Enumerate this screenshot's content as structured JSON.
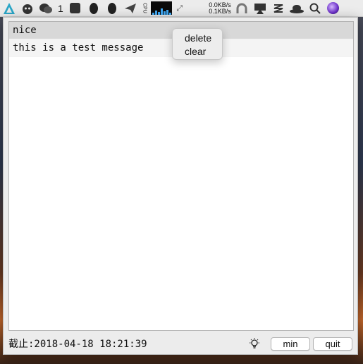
{
  "menubar": {
    "icons": [
      "app-a-icon",
      "cat-icon",
      "wechat-icon",
      "note-icon",
      "qq-icon",
      "qq-icon",
      "paper-plane-icon",
      "cpu-icon",
      "activity-graph-icon",
      "expand-icon",
      "network-speed-icon",
      "headphones-icon",
      "airplay-icon",
      "zip-icon",
      "hat-icon",
      "search-icon",
      "siri-icon"
    ],
    "wechat_count": "1",
    "cpu_label": "CPU",
    "net_up": "0.0KB/s",
    "net_down": "0.1KB/s"
  },
  "list": {
    "header_item": "nice",
    "items": [
      "this is a test message"
    ]
  },
  "context_menu": {
    "items": [
      "delete",
      "clear"
    ]
  },
  "status": {
    "deadline": "截止:2018-04-18 18:21:39",
    "min_label": "min",
    "quit_label": "quit"
  }
}
